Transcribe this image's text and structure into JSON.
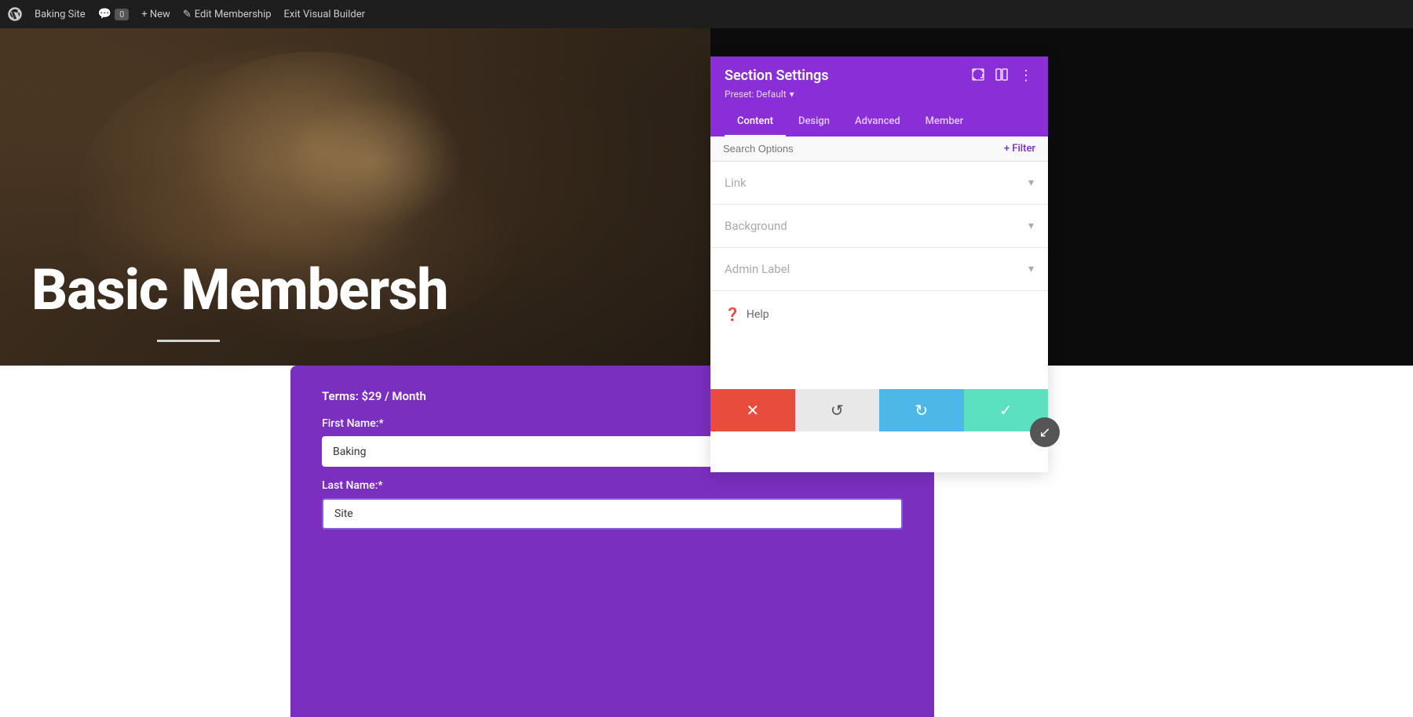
{
  "admin_bar": {
    "wp_icon": "⊕",
    "site_name": "Baking Site",
    "comments_icon": "💬",
    "comments_count": "0",
    "new_label": "+ New",
    "edit_icon": "✎",
    "edit_label": "Edit Membership",
    "exit_label": "Exit Visual Builder"
  },
  "hero": {
    "title": "Basic Membersh"
  },
  "form": {
    "terms_label": "Terms: $29 / Month",
    "first_name_label": "First Name:*",
    "first_name_value": "Baking",
    "last_name_label": "Last Name:*",
    "last_name_value": "Site"
  },
  "settings_panel": {
    "title": "Section Settings",
    "preset_label": "Preset: Default",
    "preset_arrow": "▾",
    "tabs": [
      {
        "id": "content",
        "label": "Content",
        "active": true
      },
      {
        "id": "design",
        "label": "Design",
        "active": false
      },
      {
        "id": "advanced",
        "label": "Advanced",
        "active": false
      },
      {
        "id": "member",
        "label": "Member",
        "active": false
      }
    ],
    "search_placeholder": "Search Options",
    "filter_label": "+ Filter",
    "sections": [
      {
        "id": "link",
        "title": "Link"
      },
      {
        "id": "background",
        "title": "Background"
      },
      {
        "id": "admin_label",
        "title": "Admin Label"
      }
    ],
    "help_label": "Help"
  },
  "action_bar": {
    "cancel_icon": "✕",
    "undo_icon": "↺",
    "redo_icon": "↻",
    "save_icon": "✓"
  },
  "float_btn": {
    "icon": "↙"
  }
}
